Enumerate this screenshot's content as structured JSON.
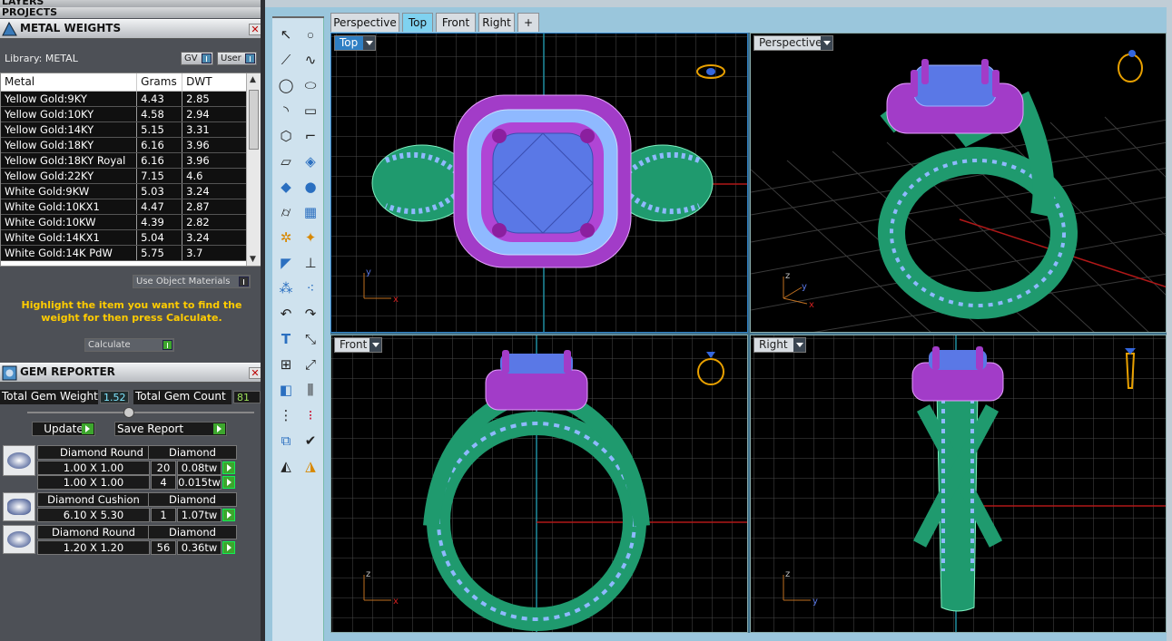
{
  "left_panel": {
    "layers_label": "LAYERS",
    "projects_label": "PROJECTS",
    "metal_weights": {
      "title": "METAL WEIGHTS",
      "library_label": "Library: METAL",
      "gv_label": "GV",
      "user_label": "User",
      "columns": [
        "Metal",
        "Grams",
        "DWT"
      ],
      "rows": [
        [
          "Yellow Gold:9KY",
          "4.43",
          "2.85"
        ],
        [
          "Yellow Gold:10KY",
          "4.58",
          "2.94"
        ],
        [
          "Yellow Gold:14KY",
          "5.15",
          "3.31"
        ],
        [
          "Yellow Gold:18KY",
          "6.16",
          "3.96"
        ],
        [
          "Yellow Gold:18KY Royal",
          "6.16",
          "3.96"
        ],
        [
          "Yellow Gold:22KY",
          "7.15",
          "4.6"
        ],
        [
          "White Gold:9KW",
          "5.03",
          "3.24"
        ],
        [
          "White Gold:10KX1",
          "4.47",
          "2.87"
        ],
        [
          "White Gold:10KW",
          "4.39",
          "2.82"
        ],
        [
          "White Gold:14KX1",
          "5.04",
          "3.24"
        ],
        [
          "White Gold:14K PdW",
          "5.75",
          "3.7"
        ]
      ],
      "use_object_materials": "Use Object Materials",
      "hint": "Highlight the item you want to find the weight for then press Calculate.",
      "calculate_label": "Calculate"
    },
    "gem_reporter": {
      "title": "GEM REPORTER",
      "total_weight_label": "Total Gem Weight",
      "total_weight_value": "1.52",
      "total_count_label": "Total Gem Count",
      "total_count_value": "81",
      "update_label": "Update",
      "save_report_label": "Save Report",
      "groups": [
        {
          "shape": "Diamond Round",
          "material": "Diamond",
          "rows": [
            {
              "size": "1.00 X 1.00",
              "count": "20",
              "weight": "0.08tw"
            },
            {
              "size": "1.00 X 1.00",
              "count": "4",
              "weight": "0.015tw"
            }
          ]
        },
        {
          "shape": "Diamond Cushion",
          "material": "Diamond",
          "rows": [
            {
              "size": "6.10 X 5.30",
              "count": "1",
              "weight": "1.07tw"
            }
          ]
        },
        {
          "shape": "Diamond Round",
          "material": "Diamond",
          "rows": [
            {
              "size": "1.20 X 1.20",
              "count": "56",
              "weight": "0.36tw"
            }
          ]
        }
      ]
    }
  },
  "viewport_tabs": [
    "Perspective",
    "Top",
    "Front",
    "Right",
    "+"
  ],
  "active_tab": "Top",
  "viewports": {
    "top": "Top",
    "perspective": "Perspective",
    "front": "Front",
    "right": "Right"
  },
  "axes": {
    "x": "x",
    "y": "y",
    "z": "z"
  },
  "colors": {
    "metal": "#1f9a6e",
    "halo": "#a23cc8",
    "stone": "#5a78e6",
    "accent_stones": "#8fb9ff",
    "active_viewport": "#2f7fc4"
  }
}
